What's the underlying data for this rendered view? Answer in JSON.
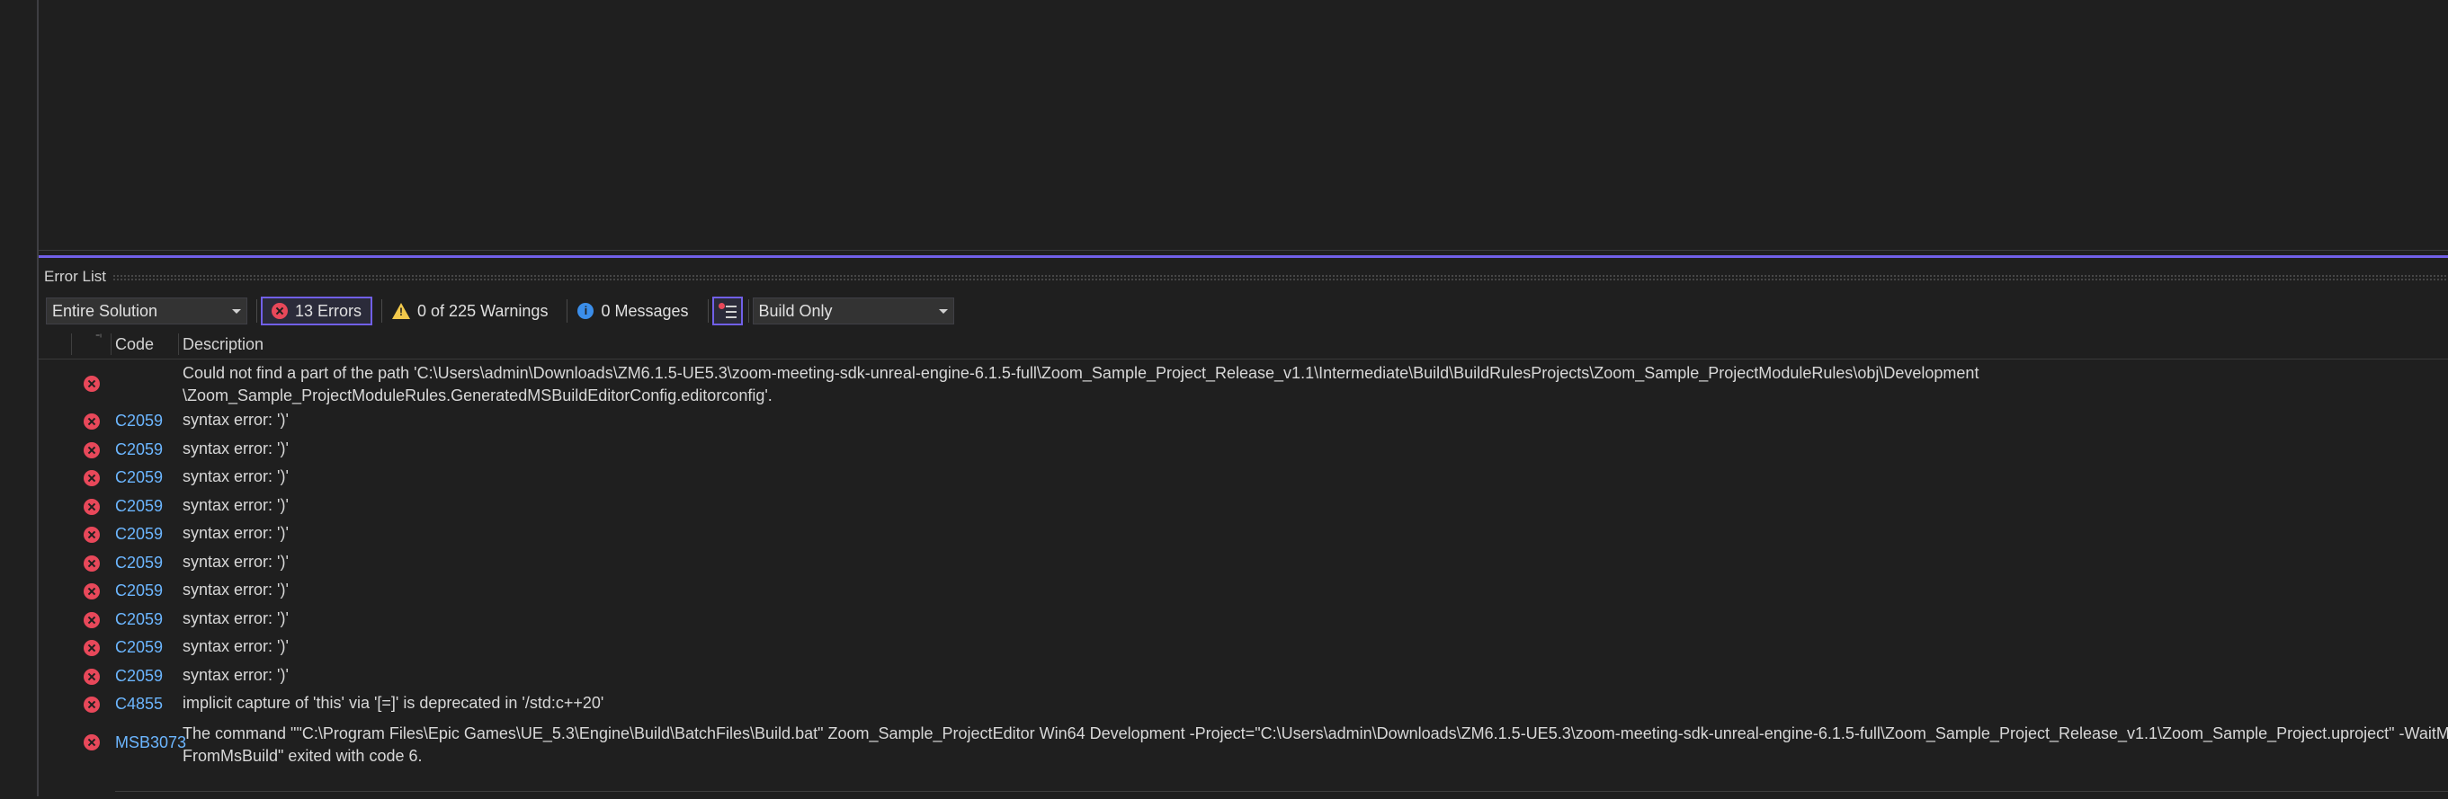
{
  "panel": {
    "title": "Error List"
  },
  "toolbar": {
    "scope_value": "Entire Solution",
    "errors_label": "13 Errors",
    "warnings_label": "0 of 225 Warnings",
    "messages_label": "0 Messages",
    "build_value": "Build Only"
  },
  "columns": {
    "code": "Code",
    "description": "Description"
  },
  "rows": [
    {
      "code": "",
      "desc1": "Could not find a part of the path 'C:\\Users\\admin\\Downloads\\ZM6.1.5-UE5.3\\zoom-meeting-sdk-unreal-engine-6.1.5-full\\Zoom_Sample_Project_Release_v1.1\\Intermediate\\Build\\BuildRulesProjects\\Zoom_Sample_ProjectModuleRules\\obj\\Development",
      "desc2": "\\Zoom_Sample_ProjectModuleRules.GeneratedMSBuildEditorConfig.editorconfig'."
    },
    {
      "code": "C2059",
      "desc1": "syntax error: ')'"
    },
    {
      "code": "C2059",
      "desc1": "syntax error: ')'"
    },
    {
      "code": "C2059",
      "desc1": "syntax error: ')'"
    },
    {
      "code": "C2059",
      "desc1": "syntax error: ')'"
    },
    {
      "code": "C2059",
      "desc1": "syntax error: ')'"
    },
    {
      "code": "C2059",
      "desc1": "syntax error: ')'"
    },
    {
      "code": "C2059",
      "desc1": "syntax error: ')'"
    },
    {
      "code": "C2059",
      "desc1": "syntax error: ')'"
    },
    {
      "code": "C2059",
      "desc1": "syntax error: ')'"
    },
    {
      "code": "C2059",
      "desc1": "syntax error: ')'"
    },
    {
      "code": "C4855",
      "desc1": "implicit capture of 'this' via '[=]' is deprecated in '/std:c++20'"
    },
    {
      "code": "MSB3073",
      "desc1": "The command \"\"C:\\Program Files\\Epic Games\\UE_5.3\\Engine\\Build\\BatchFiles\\Build.bat\" Zoom_Sample_ProjectEditor Win64 Development -Project=\"C:\\Users\\admin\\Downloads\\ZM6.1.5-UE5.3\\zoom-meeting-sdk-unreal-engine-6.1.5-full\\Zoom_Sample_Project_Release_v1.1\\Zoom_Sample_Project.uproject\" -WaitMutex -",
      "desc2": "FromMsBuild\" exited with code 6."
    }
  ],
  "colors": {
    "accent": "#7160e8",
    "error": "#e8485a",
    "warning": "#f2c94c",
    "info": "#3b8eea",
    "code_link": "#6cb6ff"
  },
  "icons": {
    "error": "error-icon",
    "warning": "warning-icon",
    "info": "info-icon",
    "filter": "filter-icon"
  }
}
